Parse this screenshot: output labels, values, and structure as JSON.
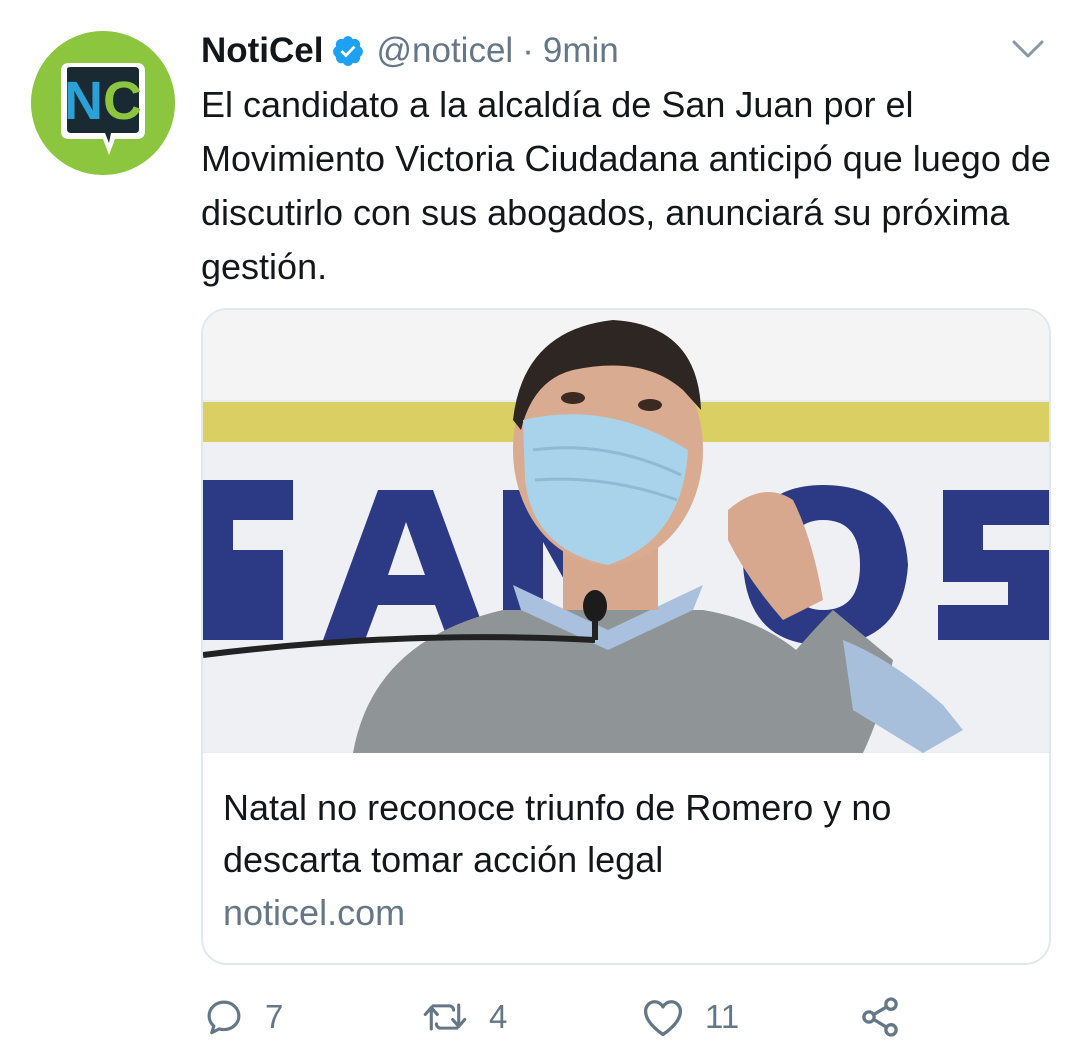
{
  "tweet": {
    "display_name": "NotiCel",
    "verified": true,
    "handle": "@noticel",
    "separator": "·",
    "time": "9min",
    "avatar_text": "NC",
    "text": "El candidato a la alcaldía de San Juan por el Movimiento Victoria Ciudadana anticipó que luego de discutirlo con sus abogados, anunciará su próxima gestión."
  },
  "card": {
    "image_alt": "Man wearing a face mask speaking at a podium",
    "title": "Natal no reconoce triunfo de Romero y no descarta tomar acción legal",
    "domain": "noticel.com"
  },
  "actions": {
    "replies": "7",
    "retweets": "4",
    "likes": "11"
  },
  "colors": {
    "text": "#14171a",
    "secondary": "#657786",
    "verified_blue": "#1da1f2",
    "avatar_green": "#8cc63f",
    "border": "#e1e8ed"
  },
  "icons": {
    "menu": "chevron-down-icon",
    "verified": "verified-badge-icon",
    "reply": "reply-icon",
    "retweet": "retweet-icon",
    "like": "heart-icon",
    "share": "share-icon"
  }
}
